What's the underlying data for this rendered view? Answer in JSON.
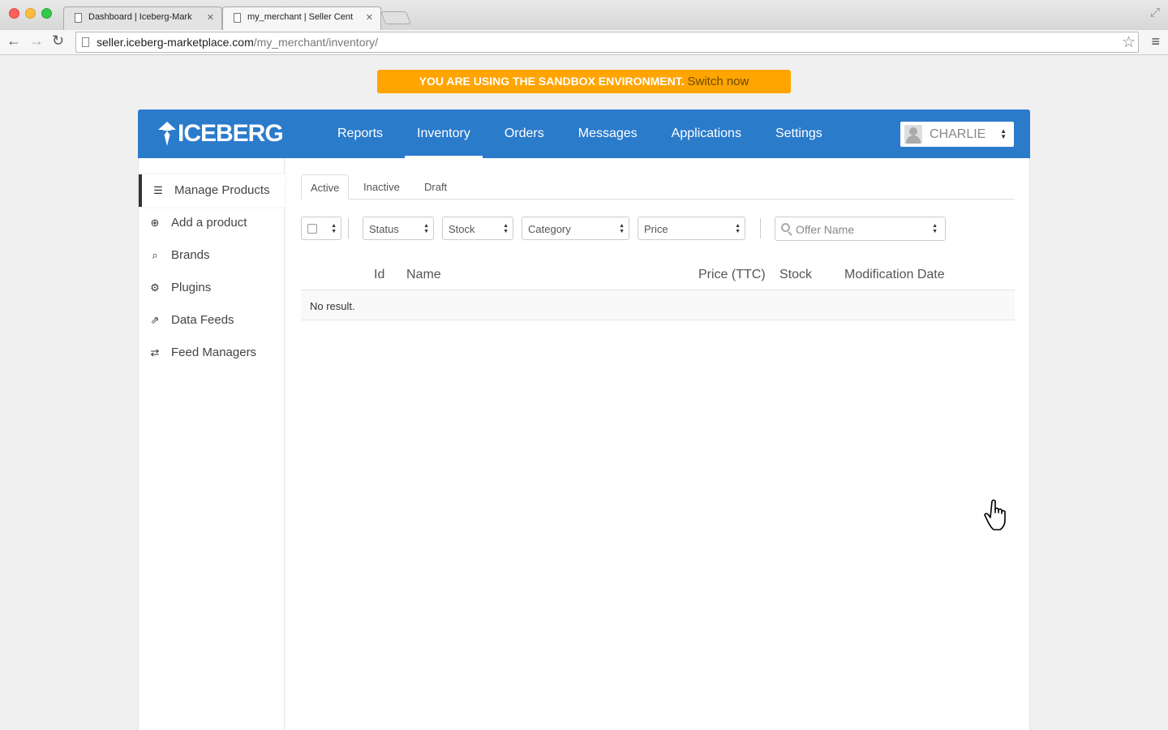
{
  "browser": {
    "tabs": [
      {
        "title": "Dashboard | Iceberg-Mark",
        "active": false
      },
      {
        "title": "my_merchant | Seller Cent",
        "active": true
      }
    ],
    "url_host": "seller.iceberg-marketplace.com",
    "url_path": "/my_merchant/inventory/"
  },
  "banner": {
    "text": "YOU ARE USING THE SANDBOX ENVIRONMENT.",
    "link": "Switch now",
    "color": "#ffa400"
  },
  "header": {
    "brand": "ICEBERG",
    "color": "#2b7bcb",
    "nav": [
      {
        "label": "Reports",
        "active": false
      },
      {
        "label": "Inventory",
        "active": true
      },
      {
        "label": "Orders",
        "active": false
      },
      {
        "label": "Messages",
        "active": false
      },
      {
        "label": "Applications",
        "active": false
      },
      {
        "label": "Settings",
        "active": false
      }
    ],
    "user": "CHARLIE"
  },
  "sidebar": {
    "items": [
      {
        "label": "Manage Products",
        "icon": "list-icon",
        "active": true
      },
      {
        "label": "Add a product",
        "icon": "plus-circle-icon",
        "active": false
      },
      {
        "label": "Brands",
        "icon": "search-icon",
        "active": false
      },
      {
        "label": "Plugins",
        "icon": "cogs-icon",
        "active": false
      },
      {
        "label": "Data Feeds",
        "icon": "share-icon",
        "active": false
      },
      {
        "label": "Feed Managers",
        "icon": "exchange-icon",
        "active": false
      }
    ]
  },
  "subtabs": [
    {
      "label": "Active",
      "active": true
    },
    {
      "label": "Inactive",
      "active": false
    },
    {
      "label": "Draft",
      "active": false
    }
  ],
  "filters": {
    "status": "Status",
    "stock": "Stock",
    "category": "Category",
    "price": "Price",
    "search_placeholder": "Offer Name"
  },
  "table": {
    "columns": [
      "Id",
      "Name",
      "Price (TTC)",
      "Stock",
      "Modification Date"
    ],
    "empty_text": "No result."
  }
}
